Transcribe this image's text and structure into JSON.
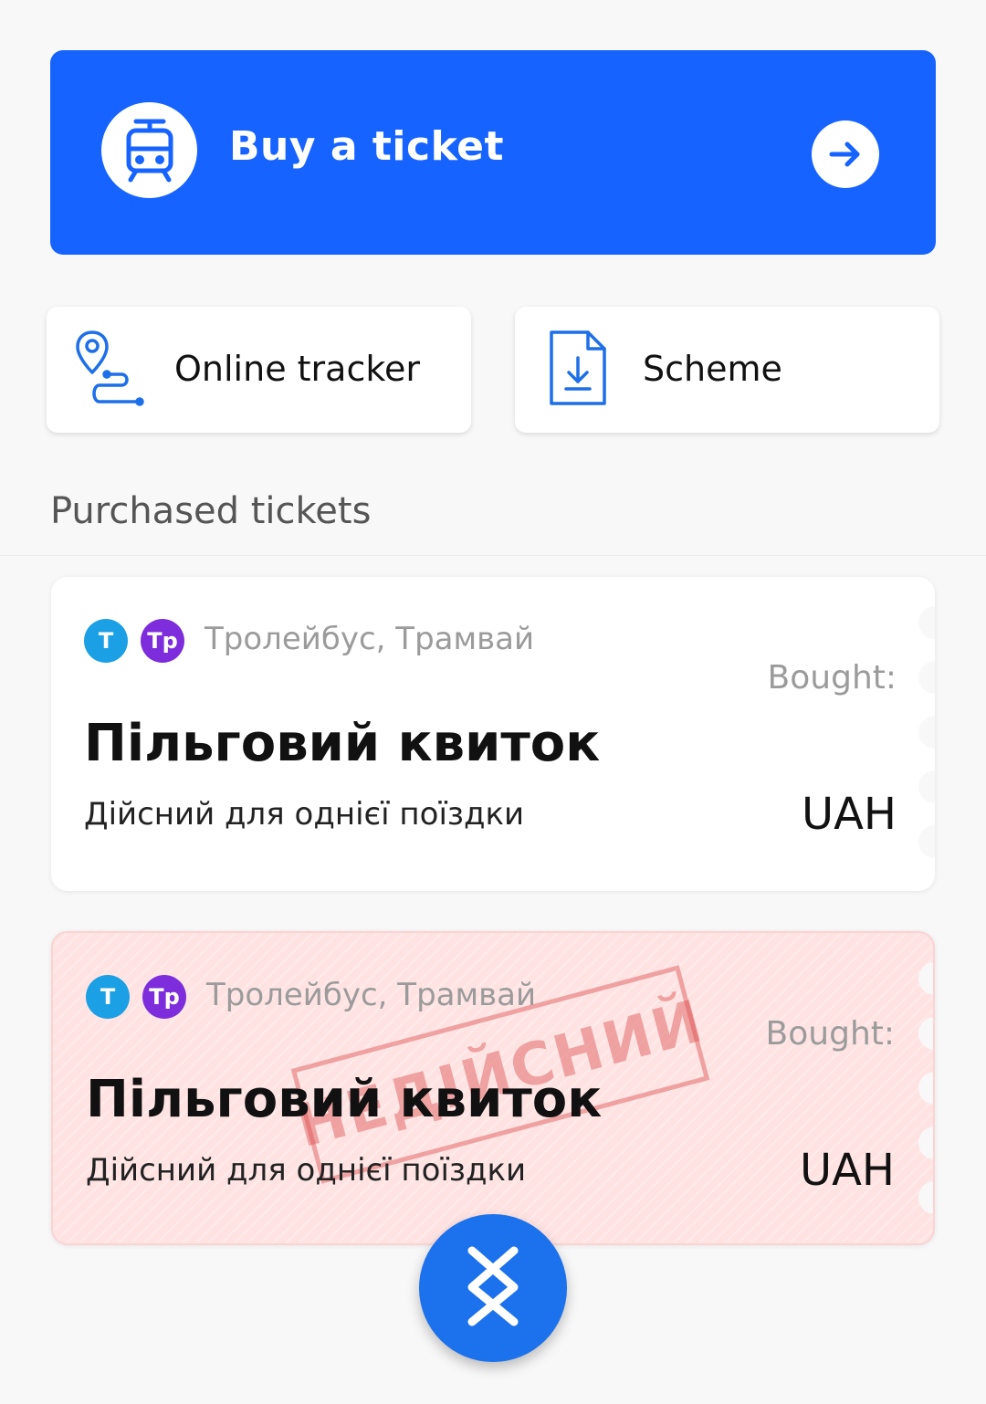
{
  "buy_ticket": {
    "label": "Buy a ticket",
    "icon": "tram-icon",
    "action_icon": "arrow-right-icon"
  },
  "quick_actions": [
    {
      "label": "Online tracker",
      "icon": "route-map-pin-icon"
    },
    {
      "label": "Scheme",
      "icon": "document-download-icon"
    }
  ],
  "section": {
    "title": "Purchased tickets"
  },
  "tickets": [
    {
      "badges": [
        "Т",
        "Тр"
      ],
      "transport": "Тролейбус, Трамвай",
      "bought_label": "Bought:",
      "title": "Пільговий квиток",
      "description": "Дійсний для однієї поїздки",
      "currency": "UAH",
      "status": "valid"
    },
    {
      "badges": [
        "Т",
        "Тр"
      ],
      "transport": "Тролейбус, Трамвай",
      "bought_label": "Bought:",
      "title": "Пільговий квиток",
      "description": "Дійсний для однієї поїздки",
      "currency": "UAH",
      "status": "invalid",
      "stamp": "НЕДІЙСНИЙ"
    }
  ],
  "fab": {
    "icon": "transfer-logo-icon"
  },
  "colors": {
    "primary": "#1663ff",
    "fab": "#1c71ec",
    "badge_t": "#1ba0e5",
    "badge_tr": "#7d2ddb",
    "invalid_bg": "#ffe3e3"
  }
}
